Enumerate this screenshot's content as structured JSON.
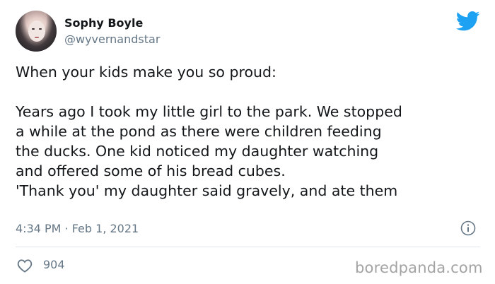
{
  "author": {
    "display_name": "Sophy Boyle",
    "handle": "@wyvernandstar",
    "avatar_icon": "avatar-photo"
  },
  "tweet": {
    "lines_block1": [
      "When your kids make you so proud:"
    ],
    "lines_block2": [
      "Years ago I took my little girl to the park. We stopped",
      "a while at the pond as there were children feeding",
      "the ducks. One kid noticed my daughter watching",
      "and offered some of his bread cubes.",
      "'Thank you' my daughter said gravely, and ate them"
    ],
    "timestamp": "4:34 PM · Feb 1, 2021",
    "likes": "904"
  },
  "icons": {
    "brand": "twitter-bird-icon",
    "info": "info-icon",
    "like": "heart-icon"
  },
  "watermark": "boredpanda.com",
  "colors": {
    "brand_blue": "#1da1f2",
    "text": "#14171a",
    "muted": "#657786",
    "divider": "#e1e8ed",
    "watermark": "#a3a3a3"
  }
}
